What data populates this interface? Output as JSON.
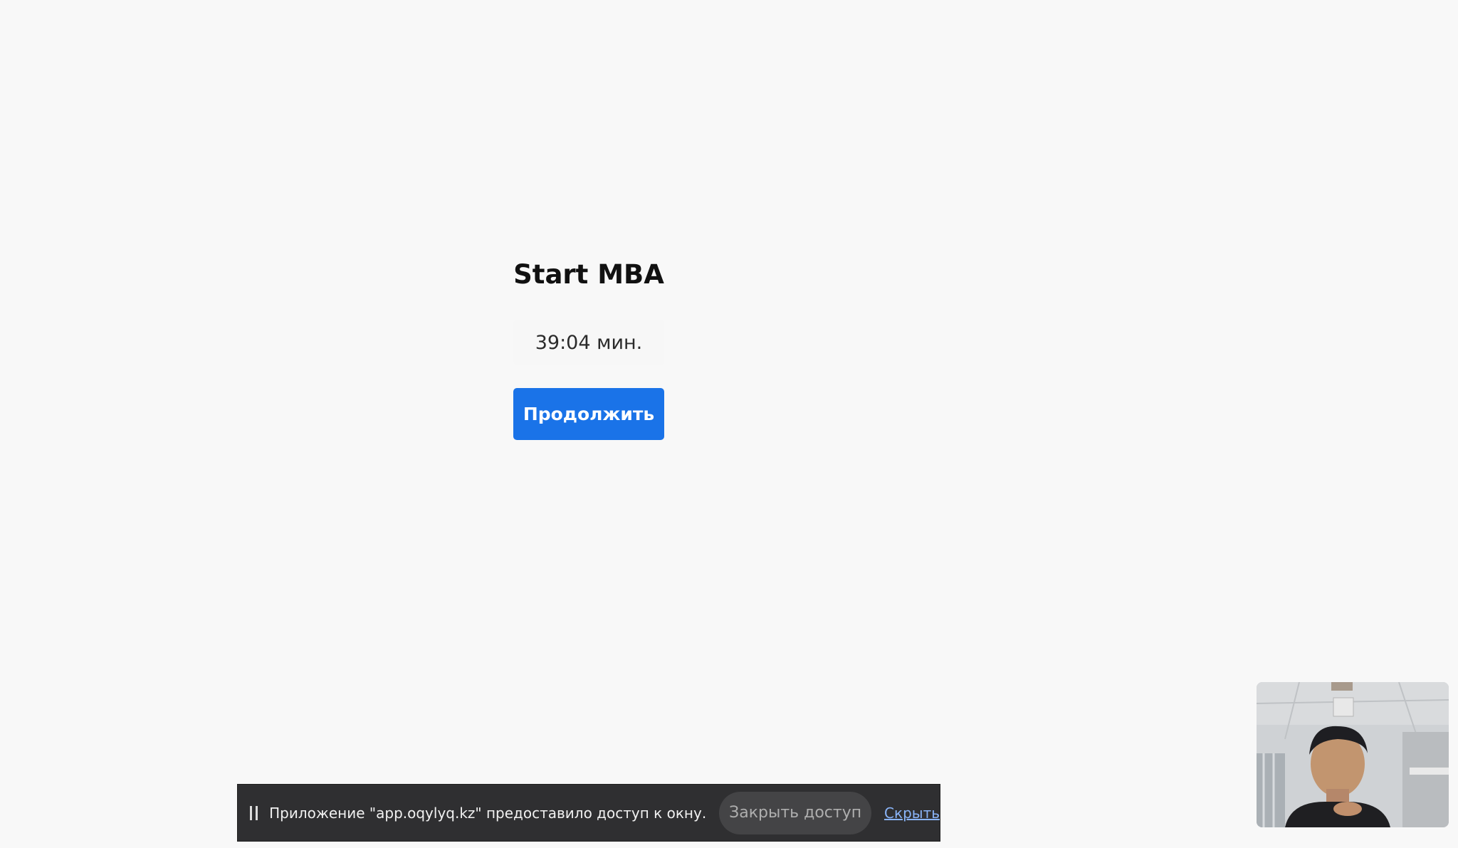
{
  "exam": {
    "title": "Start MBA",
    "timer": "39:04 мин.",
    "continue_label": "Продолжить"
  },
  "share_bar": {
    "message": "Приложение \"app.oqylyq.kz\" предоставило доступ к окну.",
    "stop_label": "Закрыть доступ",
    "hide_label": "Скрыть"
  },
  "colors": {
    "background": "#f8f8f8",
    "primary_button": "#1a73e8",
    "share_bar": "#2f2f31",
    "link": "#8ab4f8"
  },
  "icons": {
    "pause": "pause-icon"
  }
}
